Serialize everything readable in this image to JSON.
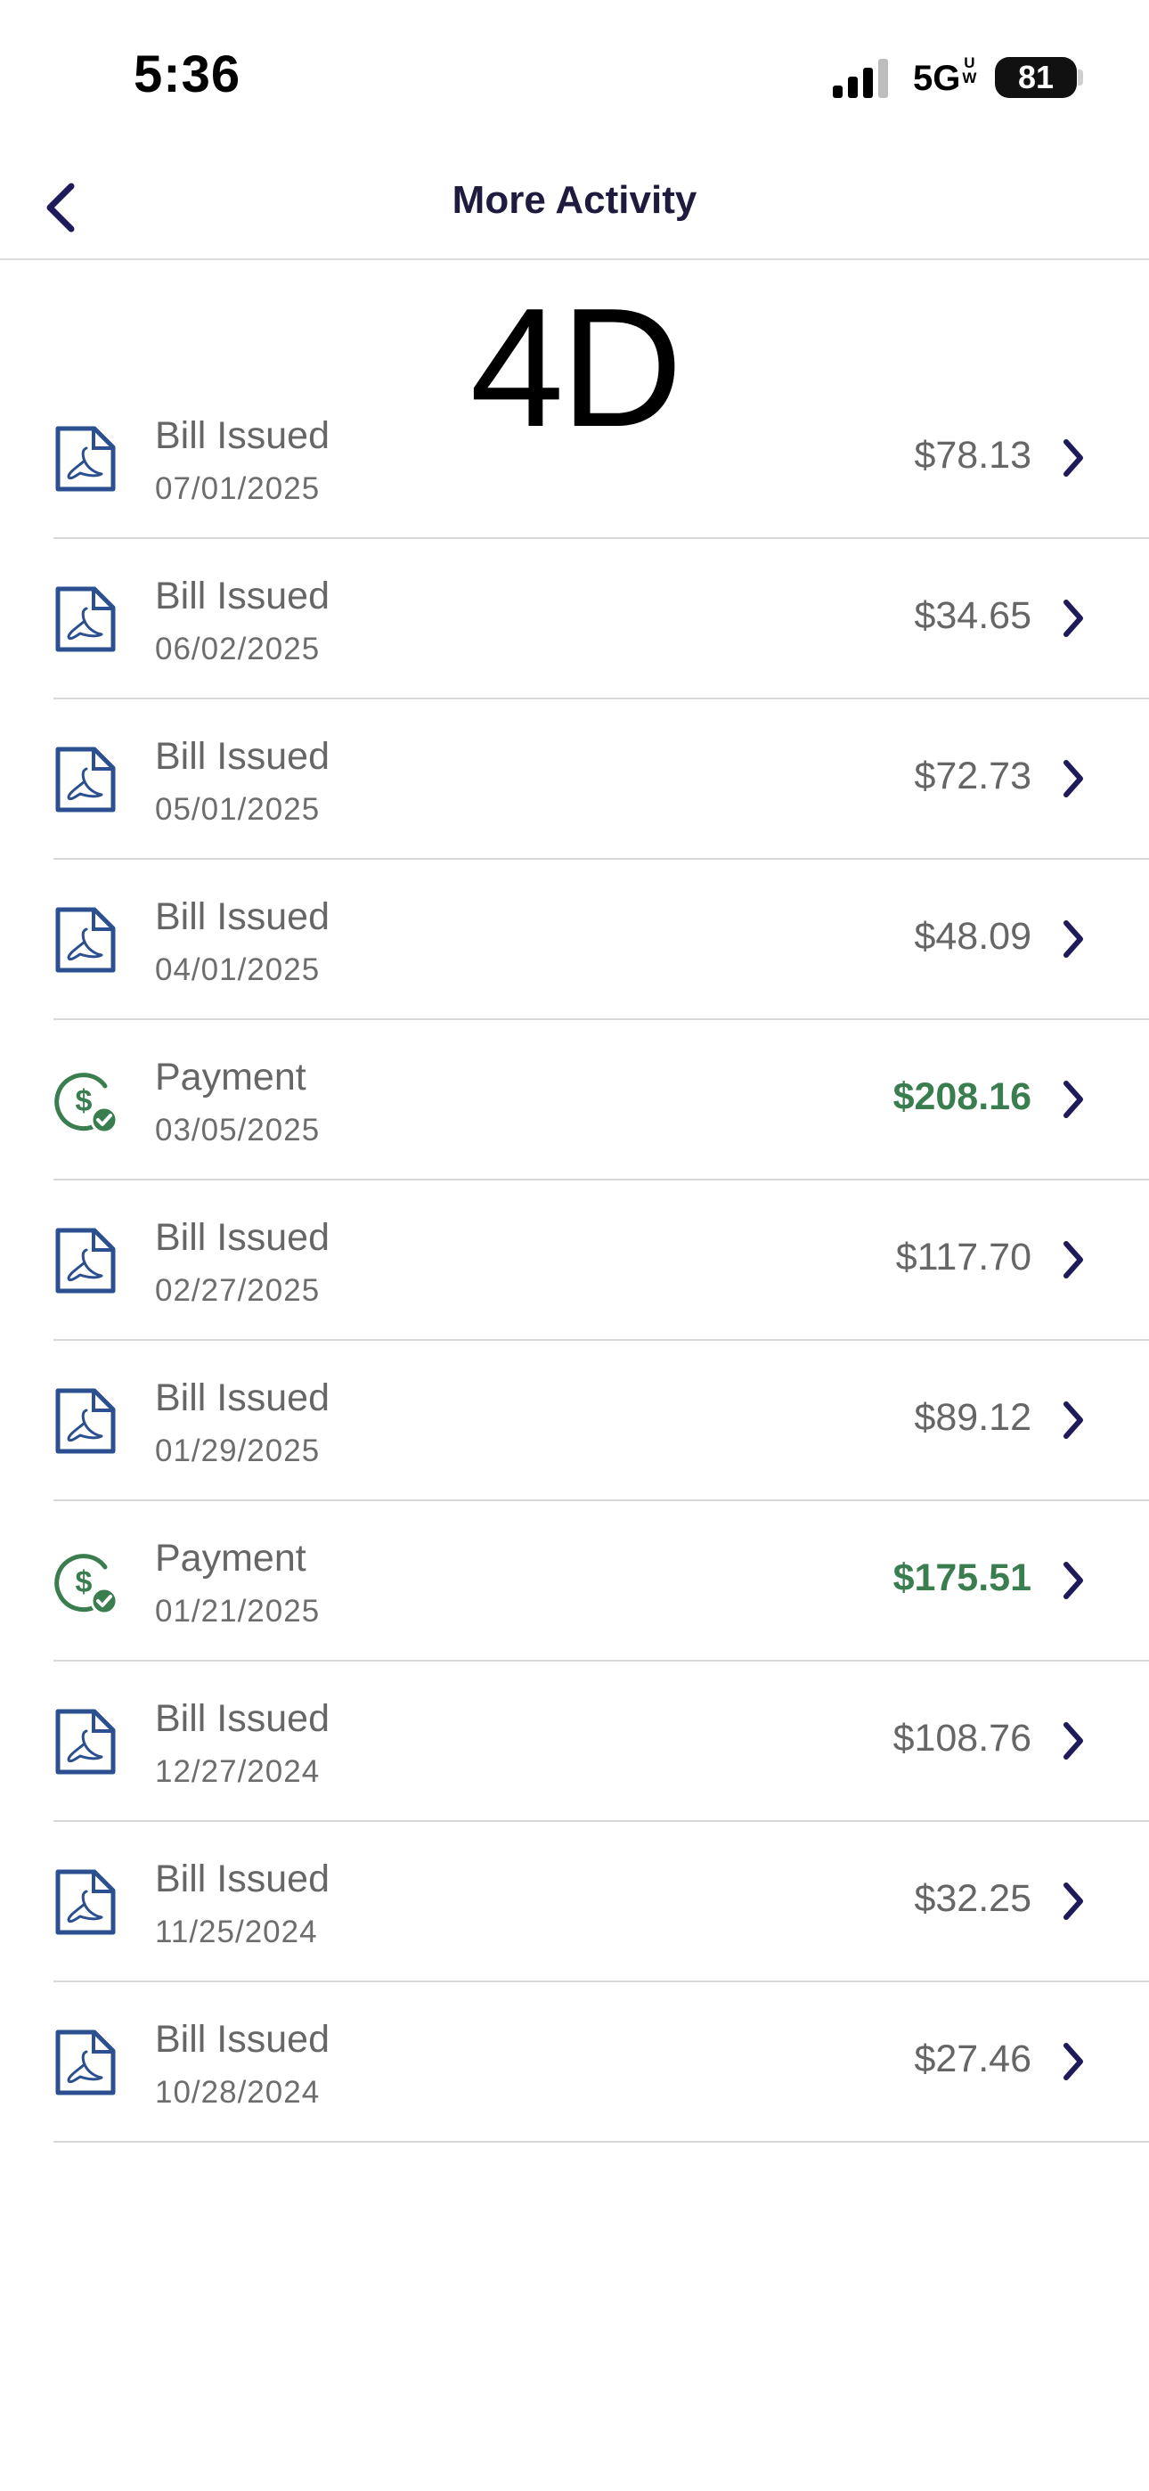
{
  "status_bar": {
    "time": "5:36",
    "network": "5G",
    "network_sup": "U",
    "network_sub": "W",
    "battery": "81"
  },
  "nav": {
    "title": "More Activity",
    "back_icon": "chevron-left-icon"
  },
  "overlay_text": "4D",
  "colors": {
    "nav_text": "#1e1b3f",
    "icon_blue": "#2b4f8f",
    "payment_green": "#3a7d4f",
    "chevron": "#1e1b5c"
  },
  "activities": [
    {
      "type": "bill",
      "label": "Bill Issued",
      "date": "07/01/2025",
      "amount": "$78.13",
      "icon": "pdf-document-icon"
    },
    {
      "type": "bill",
      "label": "Bill Issued",
      "date": "06/02/2025",
      "amount": "$34.65",
      "icon": "pdf-document-icon"
    },
    {
      "type": "bill",
      "label": "Bill Issued",
      "date": "05/01/2025",
      "amount": "$72.73",
      "icon": "pdf-document-icon"
    },
    {
      "type": "bill",
      "label": "Bill Issued",
      "date": "04/01/2025",
      "amount": "$48.09",
      "icon": "pdf-document-icon"
    },
    {
      "type": "payment",
      "label": "Payment",
      "date": "03/05/2025",
      "amount": "$208.16",
      "icon": "payment-check-icon"
    },
    {
      "type": "bill",
      "label": "Bill Issued",
      "date": "02/27/2025",
      "amount": "$117.70",
      "icon": "pdf-document-icon"
    },
    {
      "type": "bill",
      "label": "Bill Issued",
      "date": "01/29/2025",
      "amount": "$89.12",
      "icon": "pdf-document-icon"
    },
    {
      "type": "payment",
      "label": "Payment",
      "date": "01/21/2025",
      "amount": "$175.51",
      "icon": "payment-check-icon"
    },
    {
      "type": "bill",
      "label": "Bill Issued",
      "date": "12/27/2024",
      "amount": "$108.76",
      "icon": "pdf-document-icon"
    },
    {
      "type": "bill",
      "label": "Bill Issued",
      "date": "11/25/2024",
      "amount": "$32.25",
      "icon": "pdf-document-icon"
    },
    {
      "type": "bill",
      "label": "Bill Issued",
      "date": "10/28/2024",
      "amount": "$27.46",
      "icon": "pdf-document-icon"
    }
  ]
}
